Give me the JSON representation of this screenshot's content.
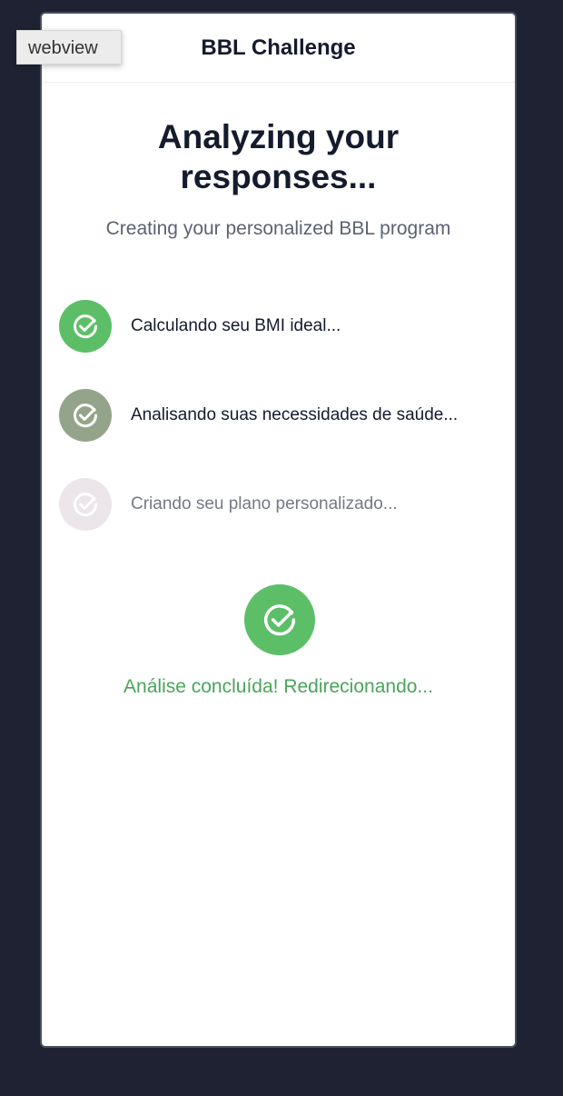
{
  "overlay": {
    "tag": "webview"
  },
  "header": {
    "title": "BBL Challenge"
  },
  "main": {
    "title_line1": "Analyzing your",
    "title_line2": "responses...",
    "subtitle": "Creating your personalized BBL program"
  },
  "steps": [
    {
      "label": "Calculando seu BMI ideal...",
      "status": "done",
      "icon": "check-circle-icon",
      "color": "#5cbf68"
    },
    {
      "label": "Analisando suas necessidades de saúde...",
      "status": "done",
      "icon": "check-circle-icon",
      "color": "#94a48a"
    },
    {
      "label": "Criando seu plano personalizado...",
      "status": "pending",
      "icon": "check-circle-icon",
      "color": "#ece6ea"
    }
  ],
  "completion": {
    "icon": "check-circle-icon",
    "color": "#5cbf68",
    "text": "Análise concluída! Redirecionando...",
    "text_color": "#49a559"
  }
}
